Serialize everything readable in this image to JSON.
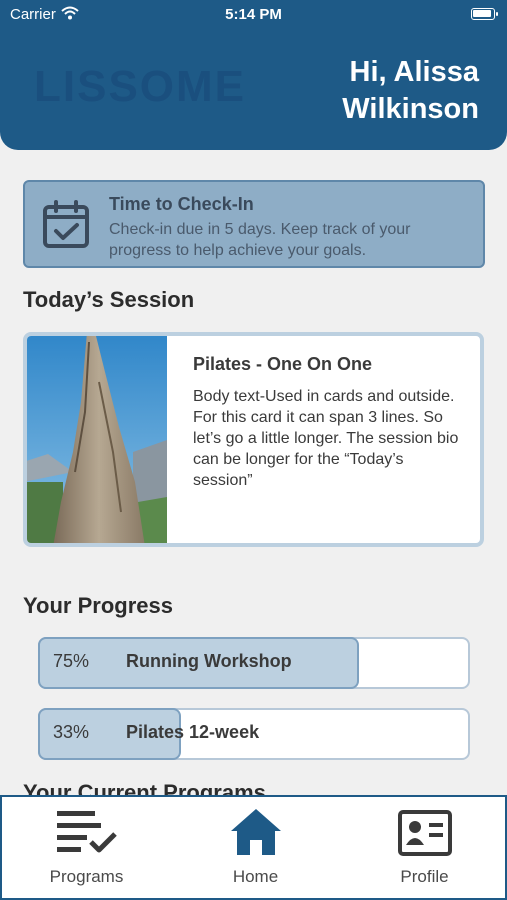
{
  "status_bar": {
    "carrier": "Carrier",
    "time": "5:14 PM"
  },
  "header": {
    "logo_text": "LISSOME",
    "greeting": "Hi, Alissa Wilkinson"
  },
  "checkin": {
    "title": "Time to Check-In",
    "description": "Check-in due in 5 days. Keep track of your progress to help achieve your goals."
  },
  "todays_session": {
    "heading": "Today’s Session",
    "card_title": "Pilates - One On One",
    "card_body": "Body text-Used in cards and outside. For this card it can span 3 lines. So let’s go a little longer. The session bio can be longer for the “Today’s session”"
  },
  "progress": {
    "heading": "Your Progress",
    "items": [
      {
        "percent_label": "75%",
        "name": "Running Workshop",
        "value": 0.75
      },
      {
        "percent_label": "33%",
        "name": "Pilates 12-week",
        "value": 0.33
      }
    ]
  },
  "current_programs": {
    "heading": "Your Current Programs"
  },
  "tabs": [
    {
      "label": "Programs",
      "icon": "list-check-icon"
    },
    {
      "label": "Home",
      "icon": "home-icon"
    },
    {
      "label": "Profile",
      "icon": "profile-card-icon"
    }
  ],
  "colors": {
    "brand_blue": "#1e5a87",
    "card_blue": "#8eadc6",
    "leaf_green": "#6aa83e"
  }
}
